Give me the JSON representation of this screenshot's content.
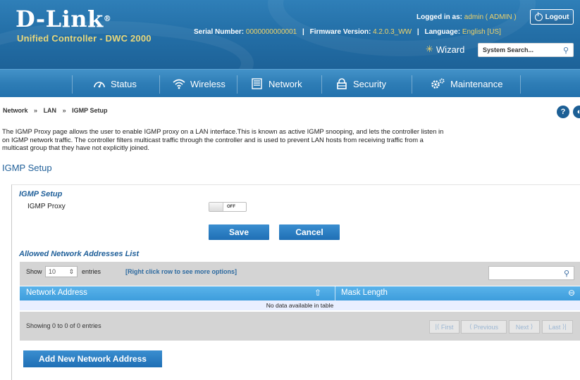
{
  "header": {
    "logo": "D-Link",
    "logo_mark": "®",
    "product": "Unified Controller - DWC 2000",
    "serial_label": "Serial Number:",
    "serial_value": "0000000000001",
    "firmware_label": "Firmware Version:",
    "firmware_value": "4.2.0.3_WW",
    "language_label": "Language:",
    "language_value": "English [US]",
    "logged_in_label": "Logged in as:",
    "logged_in_value": "admin ( ADMIN )",
    "logout_label": "Logout",
    "wizard_label": "Wizard",
    "search_placeholder": "System Search..."
  },
  "nav": {
    "items": [
      {
        "label": "Status",
        "icon": "gauge-icon"
      },
      {
        "label": "Wireless",
        "icon": "wifi-icon"
      },
      {
        "label": "Network",
        "icon": "server-icon"
      },
      {
        "label": "Security",
        "icon": "lock-icon"
      },
      {
        "label": "Maintenance",
        "icon": "gears-icon"
      }
    ]
  },
  "breadcrumb": [
    "Network",
    "LAN",
    "IGMP Setup"
  ],
  "intro_lines": [
    "The IGMP Proxy page allows the user to enable IGMP proxy on a LAN interface.This is known as active IGMP snooping, and lets the controller listen in",
    "on IGMP network traffic. The controller filters multicast traffic through the controller and is used to prevent LAN hosts from receiving traffic from a",
    "multicast group that they have not explicitly joined."
  ],
  "page_title": "IGMP Setup",
  "form": {
    "section_title": "IGMP Setup",
    "proxy_label": "IGMP Proxy",
    "proxy_state": "OFF",
    "save_label": "Save",
    "cancel_label": "Cancel"
  },
  "table": {
    "title": "Allowed Network Addresses List",
    "show_label": "Show",
    "page_size": "10",
    "entries_label": "entries",
    "hint": "[Right click row to see more options]",
    "columns": [
      "Network Address",
      "Mask Length"
    ],
    "empty_text": "No data available in table",
    "info": "Showing 0 to 0 of 0 entries",
    "pager": [
      "First",
      "Previous",
      "Next",
      "Last"
    ],
    "add_label": "Add New Network Address"
  }
}
